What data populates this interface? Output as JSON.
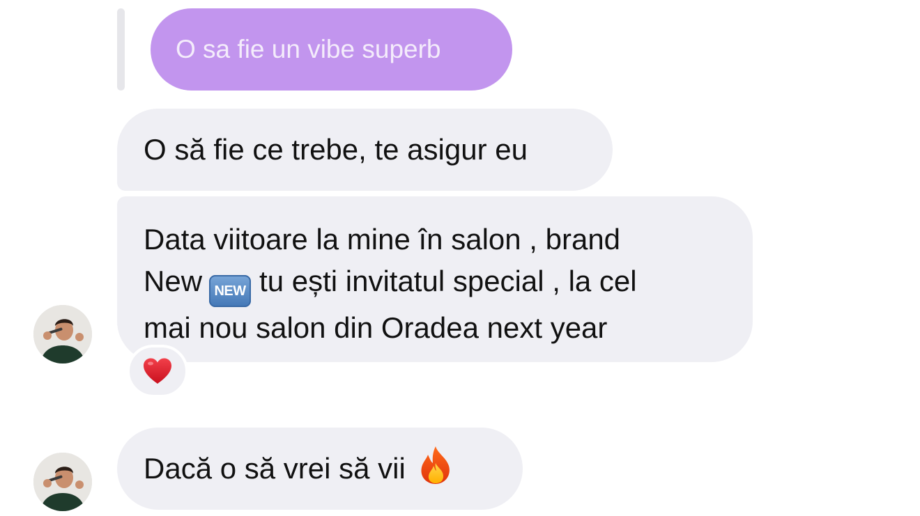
{
  "quoted_reply": {
    "text": "O sa fie un vibe superb"
  },
  "messages": [
    {
      "text": "O să fie ce trebe, te asigur eu"
    },
    {
      "line1": "Data viitoare la mine în salon , brand",
      "line2_before": "New",
      "badge": "NEW",
      "line2_after": "tu ești invitatul special , la cel",
      "line3": "mai nou salon din Oradea next year",
      "reaction_icon": "red-heart-icon"
    },
    {
      "text": "Dacă o să vrei să vii",
      "trailing_icon": "fire-icon"
    }
  ],
  "colors": {
    "quoted_bubble": "#c295ee",
    "incoming_bubble": "#efeff4",
    "badge_blue": "#4377b6"
  }
}
